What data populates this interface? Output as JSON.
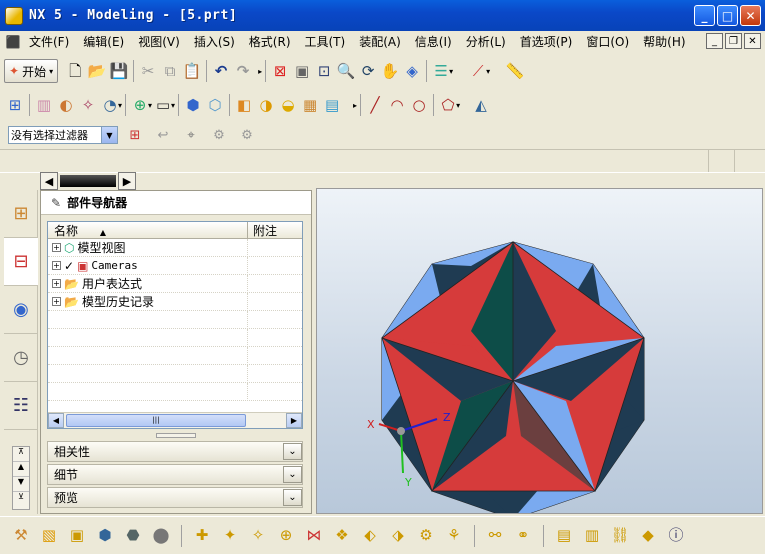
{
  "window": {
    "title": "NX 5 - Modeling - [5.prt]"
  },
  "menu": [
    "文件(F)",
    "编辑(E)",
    "视图(V)",
    "插入(S)",
    "格式(R)",
    "工具(T)",
    "装配(A)",
    "信息(I)",
    "分析(L)",
    "首选项(P)",
    "窗口(O)",
    "帮助(H)"
  ],
  "toolbar": {
    "start_label": "开始"
  },
  "filter": {
    "value": "没有选择过滤器"
  },
  "navigator": {
    "title": "部件导航器",
    "col_name": "名称",
    "col_note": "附注",
    "rows": [
      {
        "label": "模型视图"
      },
      {
        "label": "Cameras"
      },
      {
        "label": "用户表达式"
      },
      {
        "label": "模型历史记录"
      }
    ],
    "panels": [
      "相关性",
      "细节",
      "预览"
    ]
  },
  "axes": {
    "x": "X",
    "y": "Y",
    "z": "Z"
  },
  "colors": {
    "face_red": "#d63b3b",
    "face_blue": "#7aaaf0",
    "face_dark": "#1f3b52",
    "face_teal": "#0d4d48"
  }
}
